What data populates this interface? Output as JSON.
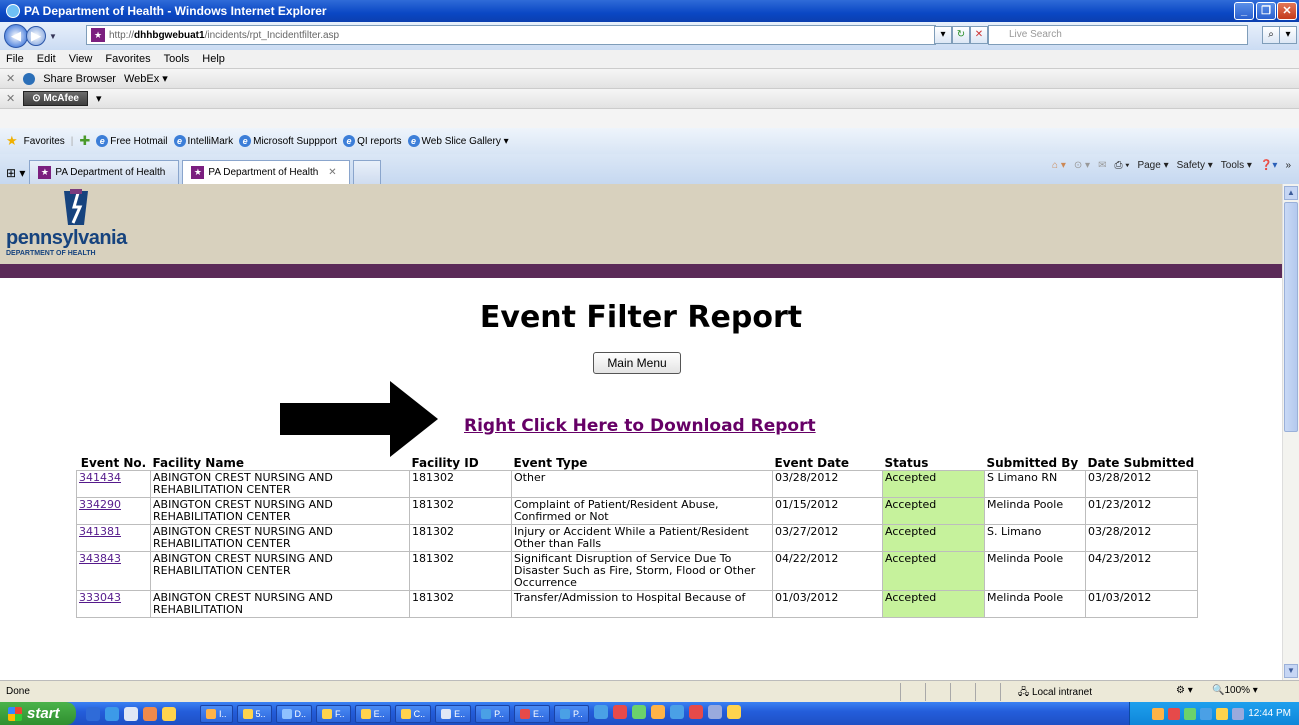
{
  "window": {
    "title": "PA Department of Health - Windows Internet Explorer"
  },
  "address": {
    "url_prefix": "http://",
    "url_host": "dhhbgwebuat1",
    "url_path": "/incidents/rpt_Incidentfilter.asp",
    "search_placeholder": "Live Search"
  },
  "menu": [
    "File",
    "Edit",
    "View",
    "Favorites",
    "Tools",
    "Help"
  ],
  "toolbar1": {
    "share": "Share Browser",
    "webex": "WebEx"
  },
  "toolbar2": {
    "mcafee": "McAfee"
  },
  "favorites": {
    "label": "Favorites",
    "links": [
      "Free Hotmail",
      "IntelliMark",
      "Microsoft Suppport",
      "QI reports",
      "Web Slice Gallery"
    ]
  },
  "tabs": [
    {
      "label": "PA Department of Health"
    },
    {
      "label": "PA Department of Health"
    }
  ],
  "commands": {
    "page": "Page",
    "safety": "Safety",
    "tools": "Tools"
  },
  "logo": {
    "name": "pennsylvania",
    "sub": "DEPARTMENT OF HEALTH"
  },
  "page": {
    "title": "Event Filter Report",
    "main_menu": "Main Menu",
    "download_link": "Right Click Here to Download Report"
  },
  "table": {
    "headers": [
      "Event No.",
      "Facility Name",
      "Facility ID",
      "Event Type",
      "Event Date",
      "Status",
      "Submitted By",
      "Date Submitted"
    ],
    "rows": [
      {
        "event_no": "341434",
        "facility": "ABINGTON CREST NURSING AND REHABILITATION CENTER",
        "facility_id": "181302",
        "event_type": "Other",
        "event_date": "03/28/2012",
        "status": "Accepted",
        "submitted_by": "S Limano RN",
        "date_submitted": "03/28/2012"
      },
      {
        "event_no": "334290",
        "facility": "ABINGTON CREST NURSING AND REHABILITATION CENTER",
        "facility_id": "181302",
        "event_type": "Complaint of Patient/Resident Abuse, Confirmed or Not",
        "event_date": "01/15/2012",
        "status": "Accepted",
        "submitted_by": "Melinda Poole",
        "date_submitted": "01/23/2012"
      },
      {
        "event_no": "341381",
        "facility": "ABINGTON CREST NURSING AND REHABILITATION CENTER",
        "facility_id": "181302",
        "event_type": "Injury or Accident While a Patient/Resident Other than Falls",
        "event_date": "03/27/2012",
        "status": "Accepted",
        "submitted_by": "S. Limano",
        "date_submitted": "03/28/2012"
      },
      {
        "event_no": "343843",
        "facility": "ABINGTON CREST NURSING AND REHABILITATION CENTER",
        "facility_id": "181302",
        "event_type": "Significant Disruption of Service Due To Disaster Such as Fire, Storm, Flood or Other Occurrence",
        "event_date": "04/22/2012",
        "status": "Accepted",
        "submitted_by": "Melinda Poole",
        "date_submitted": "04/23/2012"
      },
      {
        "event_no": "333043",
        "facility": "ABINGTON CREST NURSING AND REHABILITATION",
        "facility_id": "181302",
        "event_type": "Transfer/Admission to Hospital Because of",
        "event_date": "01/03/2012",
        "status": "Accepted",
        "submitted_by": "Melinda Poole",
        "date_submitted": "01/03/2012"
      }
    ]
  },
  "statusbar": {
    "left": "Done",
    "zone": "Local intranet",
    "zoom": "100%"
  },
  "taskbar": {
    "start": "start",
    "tasks": [
      "I..",
      "5..",
      "D..",
      "F..",
      "E..",
      "C..",
      "E..",
      "P..",
      "E..",
      "P.."
    ],
    "clock": "12:44 PM"
  },
  "colors": {
    "accepted_bg": "#c6f29c",
    "banner_bg": "#d8d1be",
    "purple_bar": "#5b2a58",
    "link_visited": "#660066"
  }
}
